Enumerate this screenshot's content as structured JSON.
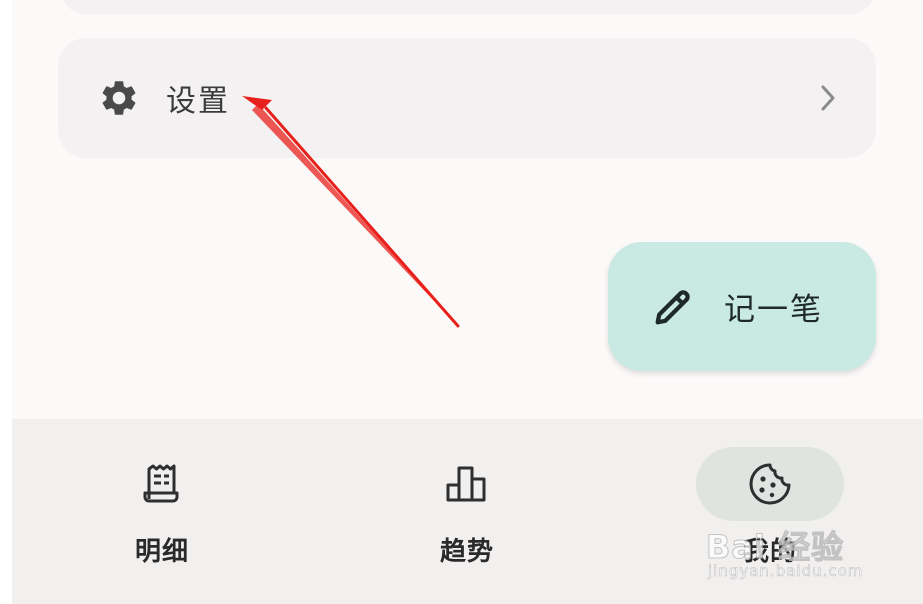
{
  "settings": {
    "label": "设置",
    "icon": "gear-icon",
    "chevron_icon": "chevron-right-icon"
  },
  "fab": {
    "label": "记一笔",
    "icon": "pencil-icon"
  },
  "bottom_nav": {
    "items": [
      {
        "label": "明细",
        "icon": "receipt-icon",
        "active": false
      },
      {
        "label": "趋势",
        "icon": "bar-chart-icon",
        "active": false
      },
      {
        "label": "我的",
        "icon": "cookie-icon",
        "active": true
      }
    ]
  },
  "watermark": {
    "line1": "Bai 经验",
    "line2": "jingyan.baidu.com"
  },
  "colors": {
    "background": "#fcfaf9",
    "card": "#f3f1f1",
    "fab": "#c9e9e3",
    "nav": "#f2efef",
    "nav_active_pill": "#dfe4e1",
    "annotation_arrow": "#e8201c"
  }
}
